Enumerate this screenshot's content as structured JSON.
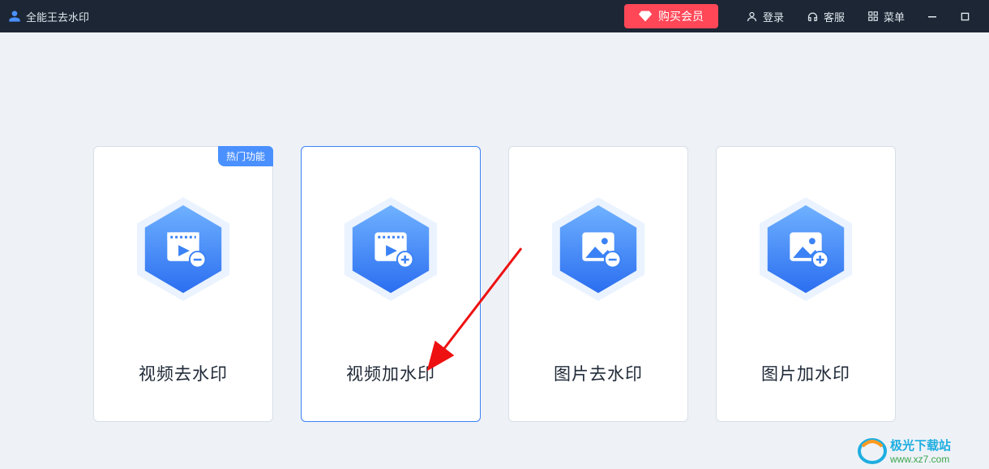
{
  "titlebar": {
    "app_name": "全能王去水印",
    "buy_label": "购买会员",
    "login_label": "登录",
    "support_label": "客服",
    "menu_label": "菜单"
  },
  "cards": [
    {
      "title": "视频去水印",
      "badge": "热门功能",
      "icon": "video-remove"
    },
    {
      "title": "视频加水印",
      "badge": null,
      "icon": "video-add",
      "active": true
    },
    {
      "title": "图片去水印",
      "badge": null,
      "icon": "image-remove"
    },
    {
      "title": "图片加水印",
      "badge": null,
      "icon": "image-add"
    }
  ],
  "watermark": {
    "brand": "极光下载站",
    "url": "www.xz7.com"
  },
  "colors": {
    "titlebar_bg": "#1c2634",
    "accent_red": "#ff4757",
    "accent_blue": "#4a90ff",
    "card_border": "#d8dee8",
    "card_border_active": "#3b82f6",
    "content_bg": "#eef2f7"
  }
}
